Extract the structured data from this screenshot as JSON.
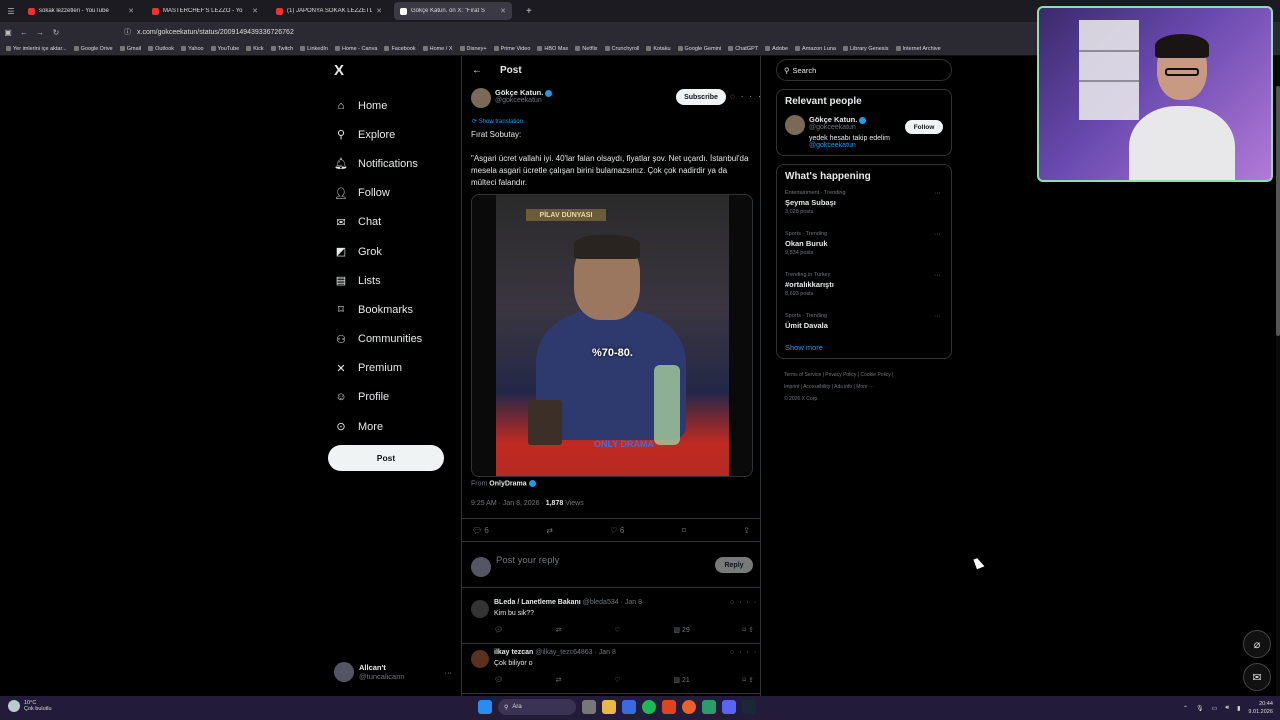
{
  "browser": {
    "tabs": [
      {
        "label": "sokak lezzetleri - YouTube",
        "active": false
      },
      {
        "label": "MASTERCHEF'S LEZZO - Yo",
        "active": false
      },
      {
        "label": "(1) JAPONYA SOKAK LEZZETLE",
        "active": false
      },
      {
        "label": "Gökçe Katun. on X: \"Fırat S",
        "active": true
      }
    ],
    "url": "x.com/gokceekatun/status/2009149439336726762",
    "bookmarks": [
      "Yer imlerini içe aktar...",
      "Google Drive",
      "Gmail",
      "Outlook",
      "Yahoo",
      "YouTube",
      "Kick",
      "Twitch",
      "LinkedIn",
      "Home - Canva",
      "Facebook",
      "Home / X",
      "Disney+",
      "Prime Video",
      "HBO Max",
      "Netflix",
      "Crunchyroll",
      "Kotaku",
      "Google Gemini",
      "ChatGPT",
      "Adobe",
      "Amazon Luna",
      "Library Genesis",
      "Internet Archive"
    ]
  },
  "nav": {
    "logo": "X",
    "items": [
      "Home",
      "Explore",
      "Notifications",
      "Follow",
      "Chat",
      "Grok",
      "Lists",
      "Bookmarks",
      "Communities",
      "Premium",
      "Profile",
      "More"
    ],
    "post_button": "Post",
    "account": {
      "name": "Allcan't",
      "handle": "@tuncalicann"
    }
  },
  "post": {
    "header": "Post",
    "author_name": "Gökçe Katun.",
    "author_handle": "@gokceekatun",
    "subscribe": "Subscribe",
    "show_translation": "Show translation",
    "text_line1": "Fırat Sobutay:",
    "text_line2": "\"Asgari ücret vallahi iyi. 40'lar falan olsaydı, fiyatlar şov. Net uçardı. İstanbul'da mesela asgari ücretle çalışan birini bulamazsınız. Çok çok nadirdir ya da mülteci falandır.",
    "video_sign": "PİLAV DÜNYASI",
    "video_caption": "%70-80.",
    "video_watermark": "ONLY DRAMA",
    "from_label": "From",
    "from_source": "OnlyDrama",
    "time": "9:25 AM · Jan 8, 2026 · ",
    "views": "1,878",
    "views_label": " Views",
    "replies_count": "6",
    "likes_count": "6",
    "reply_placeholder": "Post your reply",
    "reply_button": "Reply"
  },
  "comments": [
    {
      "name": "BLeda / Lanetleme Bakanı",
      "meta": " @bleda534 · Jan 8",
      "text": "Kim bu sik??",
      "views": "29"
    },
    {
      "name": "ilkay tezcan",
      "meta": " @ilkay_tezc64863 · Jan 8",
      "text": "Çok biliyor o",
      "views": "21"
    }
  ],
  "sidebar": {
    "search_placeholder": "Search",
    "relevant_title": "Relevant people",
    "person": {
      "name": "Gökçe Katun.",
      "handle": "@gokceekatun",
      "bio": "yedek hesabı takip edelim",
      "bio_link": "@gokceekatun",
      "follow": "Follow"
    },
    "happening_title": "What's happening",
    "trends": [
      {
        "category": "Entertainment · Trending",
        "title": "Şeyma Subaşı",
        "count": "3,028 posts"
      },
      {
        "category": "Sports · Trending",
        "title": "Okan Buruk",
        "count": "9,834 posts"
      },
      {
        "category": "Trending in Turkey",
        "title": "#ortalıkkarıştı",
        "count": "8,693 posts"
      },
      {
        "category": "Sports · Trending",
        "title": "Ümit Davala",
        "count": ""
      }
    ],
    "show_more": "Show more",
    "footer_line1": "Terms of Service  |  Privacy Policy  |  Cookie Policy  |",
    "footer_line2": "Imprint  |  Accessibility  |  Ads info  |  More ···",
    "footer_line3": "© 2026 X Corp."
  },
  "taskbar": {
    "weather_temp": "10°C",
    "weather_desc": "Çok bulutlu",
    "search": "Ara",
    "time": "20:44",
    "date": "9.01.2026"
  }
}
